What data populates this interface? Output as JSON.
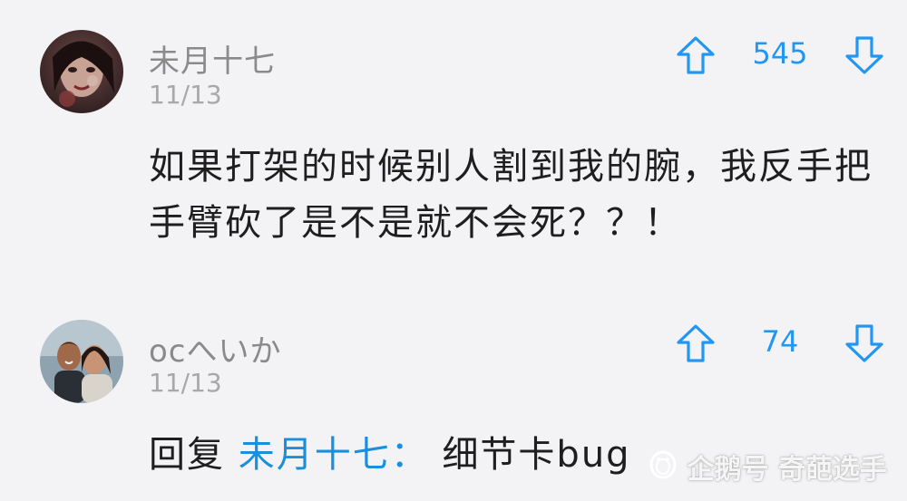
{
  "comments": [
    {
      "username": "未月十七",
      "date": "11/13",
      "votes": "545",
      "text_line1": "如果打架的时候别人割到我的腕，我反手把",
      "text_line2": "手臂砍了是不是就不会死？？！"
    },
    {
      "username": "ocへいか",
      "date": "11/13",
      "votes": "74",
      "reply_prefix": "回复",
      "reply_target": "未月十七：",
      "reply_text": "细节卡bug"
    }
  ],
  "watermark": {
    "text": "企鹅号 奇葩选手",
    "icon": "penguin-icon"
  },
  "icons": {
    "upvote": "arrow-up-outline-icon",
    "downvote": "arrow-down-outline-icon"
  },
  "colors": {
    "accent": "#2196f3",
    "reply_link": "#1a8fdb",
    "background": "#f3f3f5",
    "username": "#8a8a8a"
  }
}
